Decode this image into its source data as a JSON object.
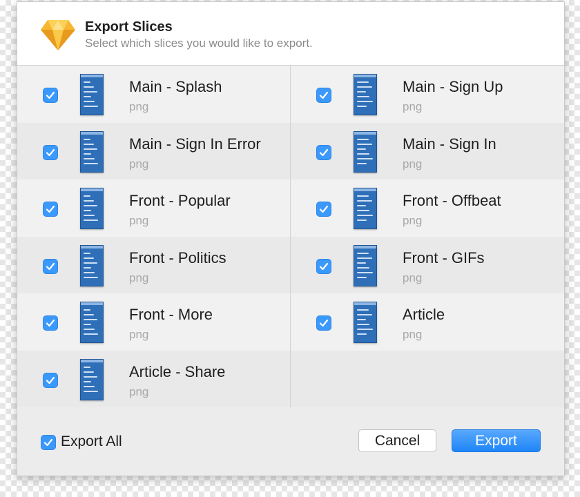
{
  "dialog": {
    "title": "Export Slices",
    "subtitle": "Select which slices you would like to export.",
    "logo_icon": "sketch-diamond-icon"
  },
  "slices": [
    {
      "name": "Main - Splash",
      "format": "png",
      "checked": true
    },
    {
      "name": "Main - Sign Up",
      "format": "png",
      "checked": true
    },
    {
      "name": "Main - Sign In Error",
      "format": "png",
      "checked": true
    },
    {
      "name": "Main - Sign In",
      "format": "png",
      "checked": true
    },
    {
      "name": "Front - Popular",
      "format": "png",
      "checked": true
    },
    {
      "name": "Front - Offbeat",
      "format": "png",
      "checked": true
    },
    {
      "name": "Front - Politics",
      "format": "png",
      "checked": true
    },
    {
      "name": "Front - GIFs",
      "format": "png",
      "checked": true
    },
    {
      "name": "Front - More",
      "format": "png",
      "checked": true
    },
    {
      "name": "Article",
      "format": "png",
      "checked": true
    },
    {
      "name": "Article - Share",
      "format": "png",
      "checked": true
    }
  ],
  "footer": {
    "export_all_label": "Export All",
    "export_all_checked": true,
    "cancel_label": "Cancel",
    "export_label": "Export"
  },
  "colors": {
    "accent": "#3b99fc",
    "thumbnail": "#2f6fb8"
  }
}
